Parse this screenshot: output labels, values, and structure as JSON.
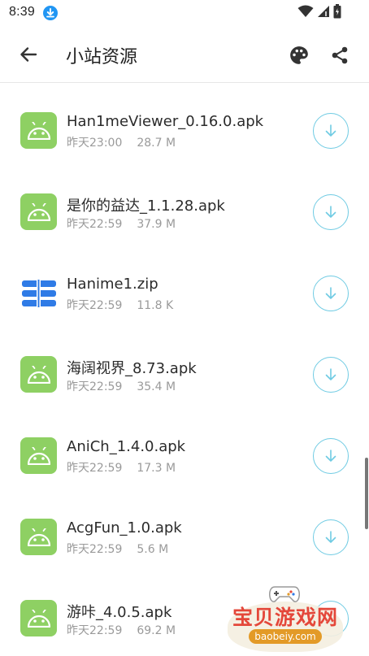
{
  "status_bar": {
    "time": "8:39"
  },
  "app_bar": {
    "title": "小站资源"
  },
  "files": [
    {
      "name": "Han1meViewer_0.16.0.apk",
      "time": "昨天23:00",
      "size": "28.7 M",
      "icon": "android-icon"
    },
    {
      "name": "是你的益达_1.1.28.apk",
      "time": "昨天22:59",
      "size": "37.9 M",
      "icon": "android-icon"
    },
    {
      "name": "Hanime1.zip",
      "time": "昨天22:59",
      "size": "11.8 K",
      "icon": "archive-icon"
    },
    {
      "name": "海阔视界_8.73.apk",
      "time": "昨天22:59",
      "size": "35.4 M",
      "icon": "android-icon"
    },
    {
      "name": "AniCh_1.4.0.apk",
      "time": "昨天22:59",
      "size": "17.3 M",
      "icon": "android-icon"
    },
    {
      "name": "AcgFun_1.0.apk",
      "time": "昨天22:59",
      "size": "5.6 M",
      "icon": "android-icon"
    },
    {
      "name": "游咔_4.0.5.apk",
      "time": "昨天22:59",
      "size": "69.2 M",
      "icon": "android-icon"
    }
  ],
  "watermark": {
    "text": "宝贝游戏网",
    "url": "baobeiy.com"
  },
  "colors": {
    "apk_icon_bg": "#8ed063",
    "archive_icon": "#2f7be6",
    "download_ring": "#6fcbe3",
    "status_download": "#2196f3"
  }
}
